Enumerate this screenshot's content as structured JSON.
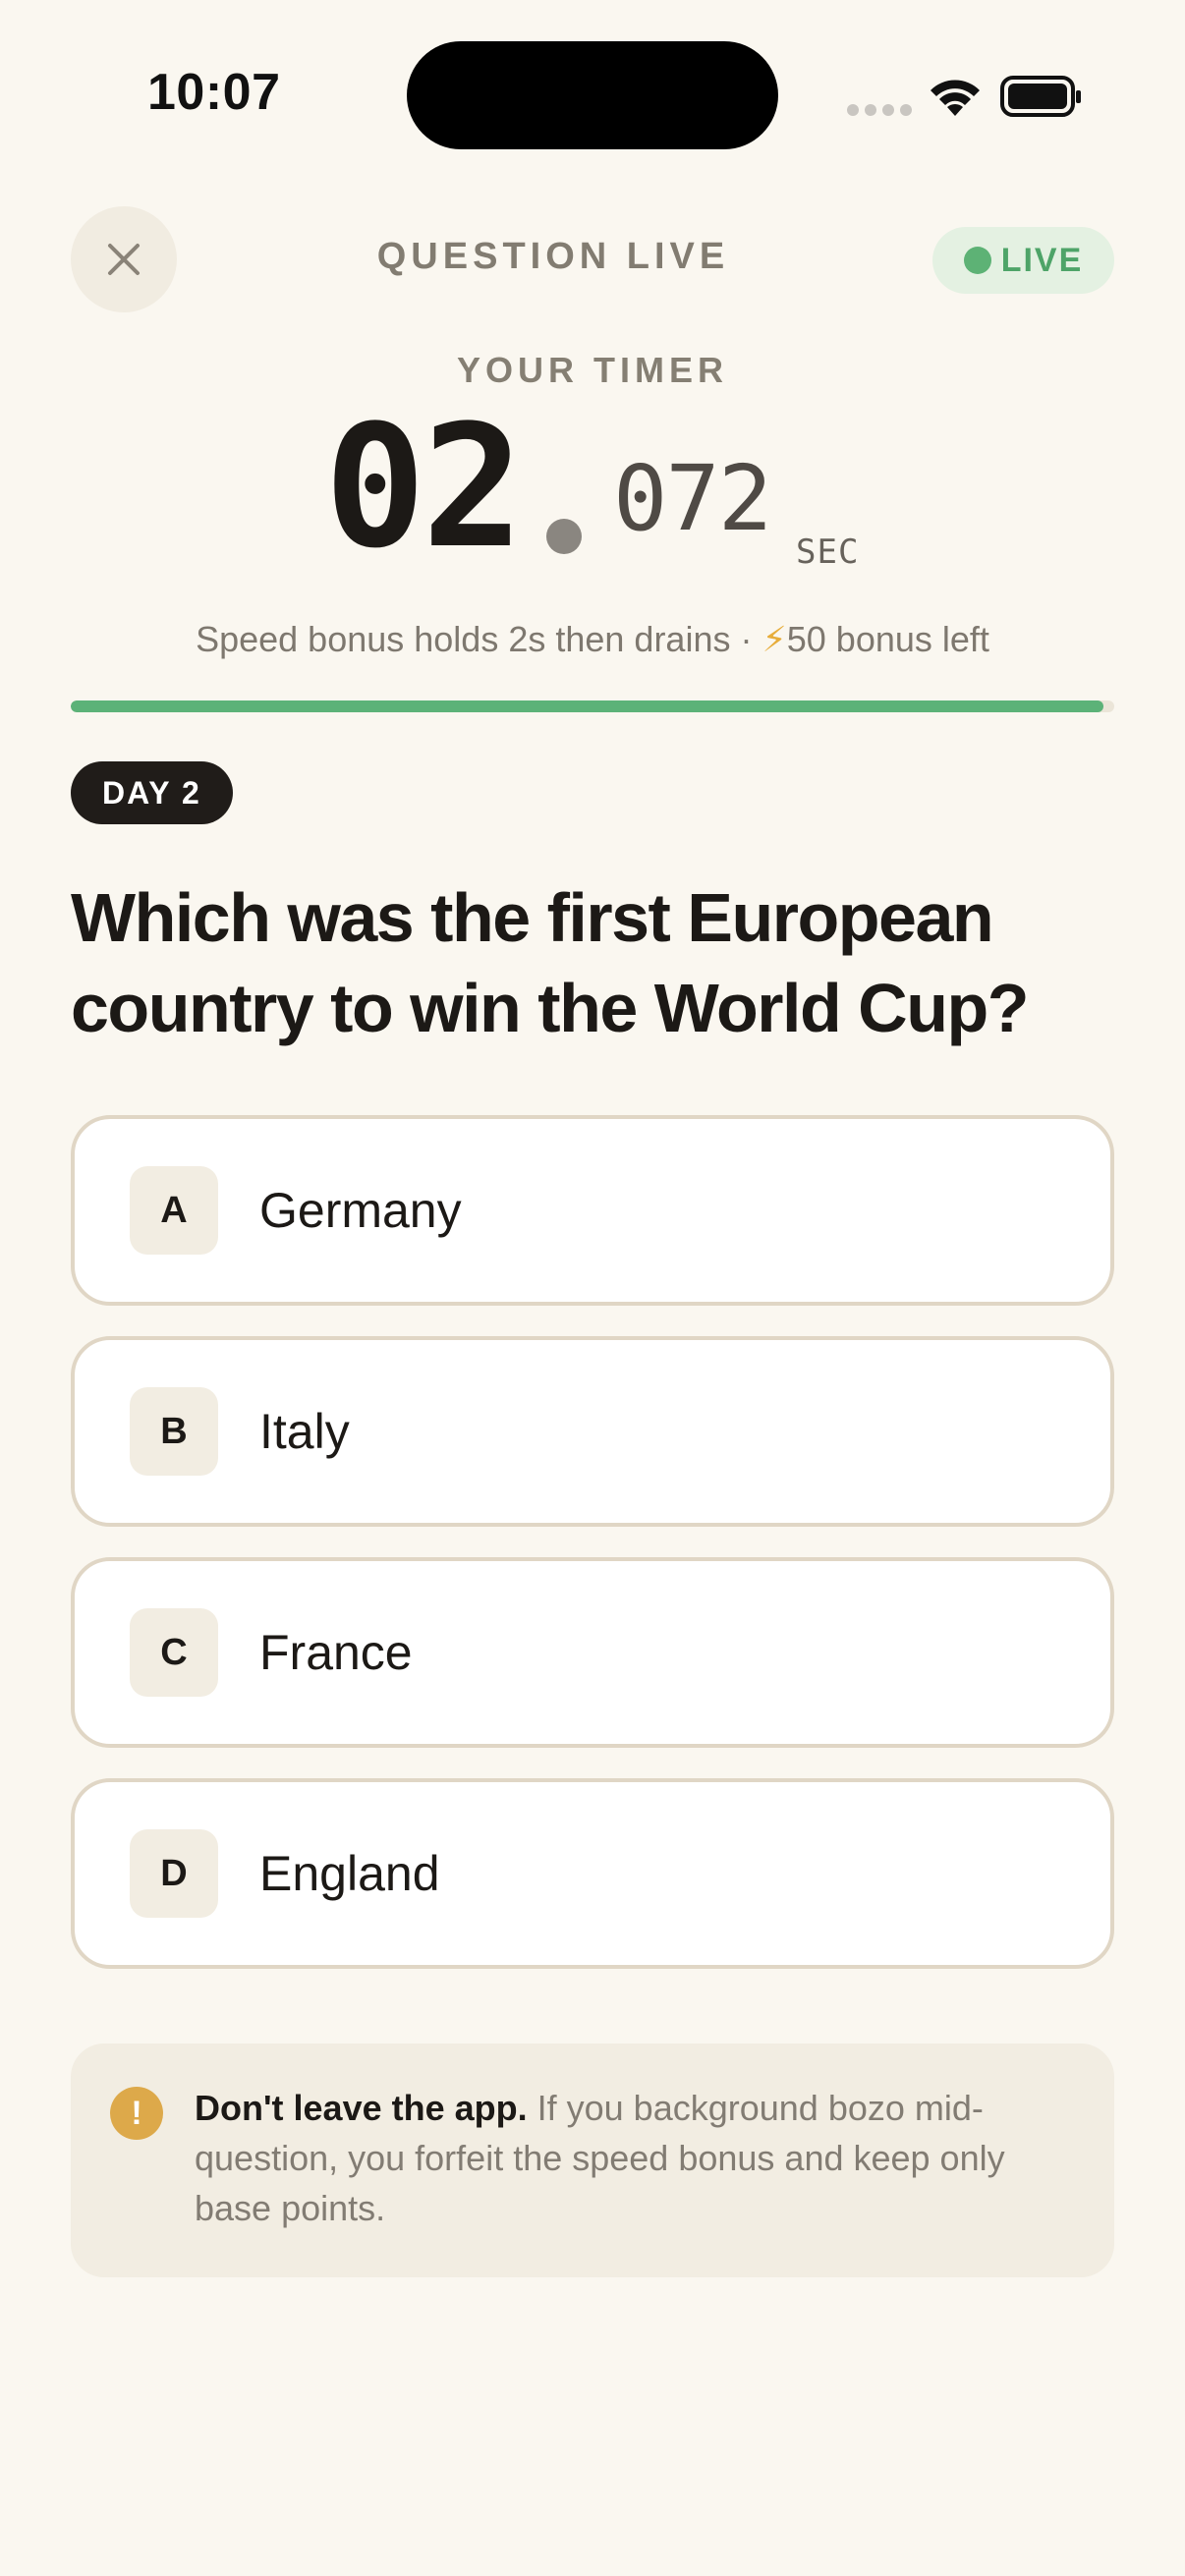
{
  "status_bar": {
    "time": "10:07"
  },
  "header": {
    "title": "QUESTION LIVE",
    "live_label": "LIVE"
  },
  "timer": {
    "label": "YOUR TIMER",
    "seconds": "02",
    "fraction": "072",
    "unit": "SEC",
    "bonus_note_prefix": "Speed bonus holds 2s then drains · ",
    "bonus_icon": "⚡",
    "bonus_note_suffix": "50 bonus left",
    "progress_fraction": 0.99
  },
  "question": {
    "day_label": "DAY 2",
    "text": "Which was the first European country to win the World Cup?",
    "options": [
      {
        "letter": "A",
        "label": "Germany"
      },
      {
        "letter": "B",
        "label": "Italy"
      },
      {
        "letter": "C",
        "label": "France"
      },
      {
        "letter": "D",
        "label": "England"
      }
    ]
  },
  "warning": {
    "icon": "!",
    "title": "Don't leave the app.",
    "body": " If you background bozo mid-question, you forfeit the speed bonus and keep only base points."
  },
  "colors": {
    "background": "#faf7f0",
    "live_green": "#5db275",
    "progress_green": "#5cb278",
    "warning_amber": "#dda94a",
    "option_border": "#e0d6c5"
  },
  "icons": {
    "close": "close-icon",
    "wifi": "wifi-icon",
    "battery": "battery-icon",
    "warning": "exclamation-icon",
    "bolt": "lightning-icon"
  }
}
